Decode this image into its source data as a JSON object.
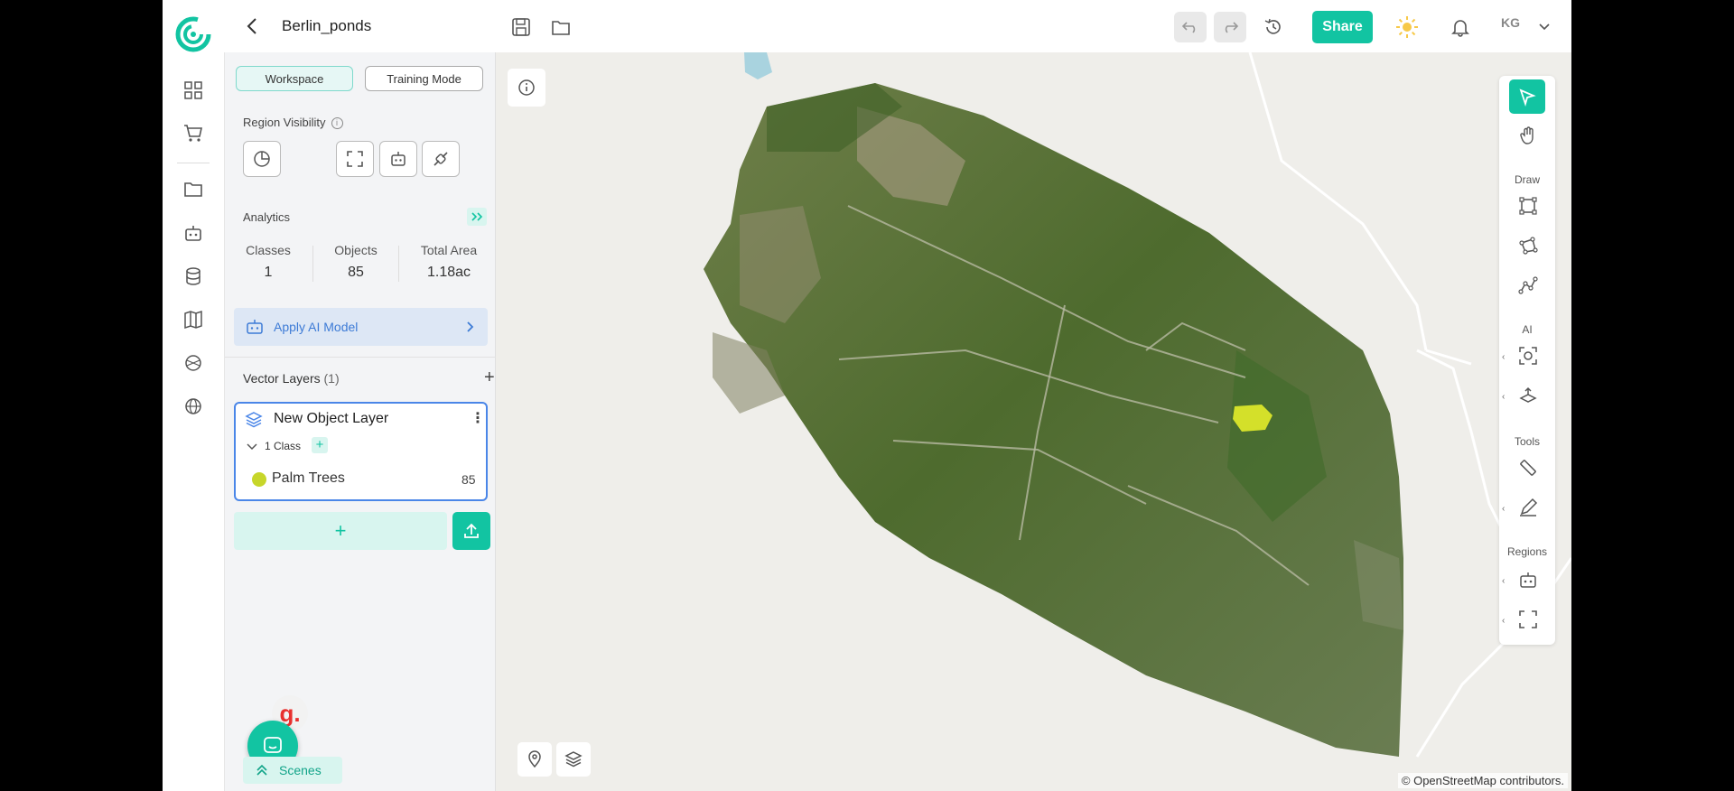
{
  "topbar": {
    "project_title": "Berlin_ponds",
    "share_label": "Share",
    "avatar_initials": "KG"
  },
  "panel": {
    "modes": [
      "Workspace",
      "Training Mode"
    ],
    "region_visibility_label": "Region Visibility",
    "analytics_label": "Analytics",
    "stats": [
      {
        "label": "Classes",
        "value": "1"
      },
      {
        "label": "Objects",
        "value": "85"
      },
      {
        "label": "Total Area",
        "value": "1.18ac"
      }
    ],
    "apply_ai_label": "Apply AI Model",
    "vector_layers_label": "Vector Layers",
    "vector_layers_count": "(1)",
    "layer": {
      "name": "New Object Layer",
      "class_count_label": "1 Class",
      "class_name": "Palm Trees",
      "class_count": "85",
      "class_color": "#c7d62a"
    },
    "scenes_label": "Scenes",
    "chat_badge": "g."
  },
  "toolbar": {
    "draw_label": "Draw",
    "ai_label": "AI",
    "tools_label": "Tools",
    "regions_label": "Regions"
  },
  "map": {
    "attribution": "© OpenStreetMap contributors."
  },
  "colors": {
    "accent": "#12c4a2",
    "ai_blue": "#3d7bd6"
  }
}
